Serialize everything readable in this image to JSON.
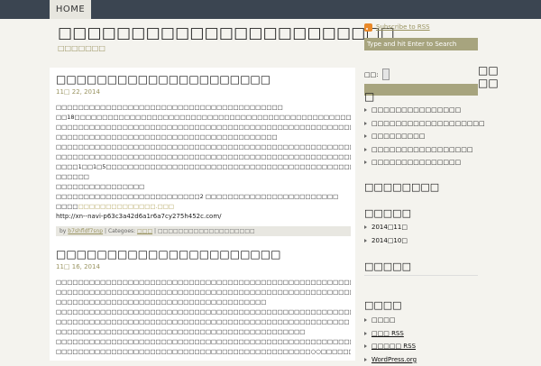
{
  "nav": {
    "home": "HOME"
  },
  "site": {
    "title": "□□□□□□□□□□□□□□□□□□□□□□□",
    "description": "□□□□□□□"
  },
  "posts": [
    {
      "title": "□□□□□□□□□□□□□□□□□□□□□",
      "date": "11□ 22, 2014",
      "lines": [
        "□□□□□□□□□□□□□□□□□□□□□□□□□□□□□□□□□□□□□□□□□",
        "□□18□□□□□□□□□□□□□□□□□□□□□□□□□□□□□□□□□□□□□□□□□□□□□□□□□□□□□□□□□□□□□□",
        "□□□□□□□□□□□□□□□□□□□□□□□□□□□□□□□□□□□□□□□□□□□□□□□□□□□□□□□□",
        "□□□□□□□□□□□□□□□□□□□□□□□□□□□□□□□□□□□□□□□□",
        "□□□□□□□□□□□□□□□□□□□□□□□□□□□□□□□□□□□□□□□□□□□□□□□□□□□□□□□□",
        "□□□□□□□□□□□□□□□□□□□□□□□□□□□□□□□□□□□□□□□□□□□□□□□□□□□□□□□□□□□",
        "□□□□1□□1□5□□□□□□□□□□□□□□□□□□□□□□□□□□□□□□□□□□□□□□□□□□□□□□□□□□□□□□□□□□□□□□□□□□□□□□□",
        "□□□□□□",
        "□□□□□□□□□□□□□□□□",
        "□□□□□□□□□□□□□□□□□□□□□□□□□□2 □□□□□□□□□□□□□□□□□□□□□□□□"
      ],
      "link_prefix": "□□□□",
      "link_text": "□□□□□□□□□□□□□□.□□□",
      "url": "http://xn--navi-p63c3a42d6a1r6a7cy275h452c.com/",
      "meta_by": "by",
      "meta_author": "b7shfldf7snp",
      "meta_categories_label": "| Categoes:",
      "meta_category": "□□□",
      "meta_tail": "| □□□□□□□□□□□□□□□□□□□"
    },
    {
      "title": "□□□□□□□□□□□□□□□□□□□□□□",
      "date": "11□ 16, 2014",
      "lines": [
        "□□□□□□□□□□□□□□□□□□□□□□□□□□□□□□□□□□□□□□□□□□□□□□□□□□□□□□□□",
        "□□□□□□□□□□□□□□□□□□□□□□□□□□□□□□□□□□□□□□□□□□□□□□□□□□□□□□□□□□□□□□□□□□□□□□□□",
        "□□□□□□□□□□□□□□□□□□□□□□□□□□□□□□□□□□□□□□",
        "□□□□□□□□□□□□□□□□□□□□□□□□□□□□□□□□□□□□□□□□□□□□□□□□□□□□□□□□□",
        "□□□□□□□□□□□□□□□□□□□□□□□□□□□□□□□□□□□□□□□□□□□□□□□□□□□□□",
        "□□□□□□□□□□□□□□□□□□□□□□□□□□□□□□□□□□□□□□□□□□□□□",
        "□□□□□□□□□□□□□□□□□□□□□□□□□□□□□□□□□□□□□□□□□□□□□□□□□□□□□□□□□□□□□□□□□□□□□□□□□□□□□□□",
        "□□□□□□□□□□□□□□□□□□□□□□□□□□□□□□□□□□□□□□□□□□□□□□○○□□□□□□□□□□□□□□□□□□□□□□□□□□□□□□□□"
      ]
    }
  ],
  "sidebar": {
    "rss_label": "Subscribe to RSS",
    "search_placeholder": "Type and hit Enter to Search",
    "search_label": "□□:",
    "right_widget_title": [
      "□□",
      "□□",
      "□"
    ],
    "recent_posts": [
      "□□□□□□□□□□□□□□□",
      "□□□□□□□□□□□□□□□□□□□",
      "□□□□□□□□□",
      "□□□□□□□□□□□□□□□□□",
      "□□□□□□□□□□□□□□□"
    ],
    "comments_title": "□□□□□□□□",
    "archives_title": "□□□□□",
    "archives": [
      "2014□11□",
      "2014□10□"
    ],
    "categories_title": "□□□□□",
    "meta_title": "□□□□",
    "meta_items": [
      "□□□□",
      "□□□ RSS",
      "□□□□□ RSS",
      "WordPress.org"
    ]
  }
}
